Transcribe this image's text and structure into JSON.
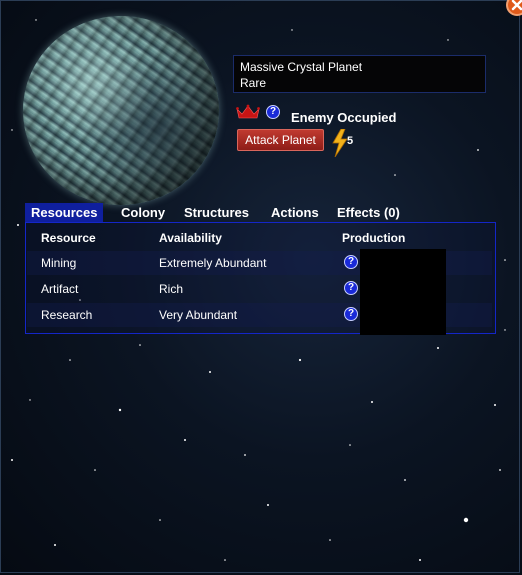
{
  "planet": {
    "name": "Massive Crystal Planet",
    "rarity": "Rare",
    "status": "Enemy Occupied",
    "attack_button": "Attack Planet",
    "cost": "5"
  },
  "tabs": [
    {
      "label": "Resources",
      "active": true
    },
    {
      "label": "Colony",
      "active": false
    },
    {
      "label": "Structures",
      "active": false
    },
    {
      "label": "Actions",
      "active": false
    },
    {
      "label": "Effects (0)",
      "active": false
    }
  ],
  "table": {
    "headers": [
      "Resource",
      "Availability",
      "Production"
    ],
    "rows": [
      {
        "resource": "Mining",
        "availability": "Extremely Abundant"
      },
      {
        "resource": "Artifact",
        "availability": "Rich"
      },
      {
        "resource": "Research",
        "availability": "Very Abundant"
      }
    ]
  },
  "icons": {
    "close": "close-icon",
    "crown": "crown-icon",
    "help": "question-icon",
    "bolt": "lightning-icon"
  },
  "colors": {
    "accent_tab": "#0f1f9e",
    "panel_border": "#1426c8",
    "attack_button": "#b0302a",
    "close_button": "#e05a1a"
  }
}
